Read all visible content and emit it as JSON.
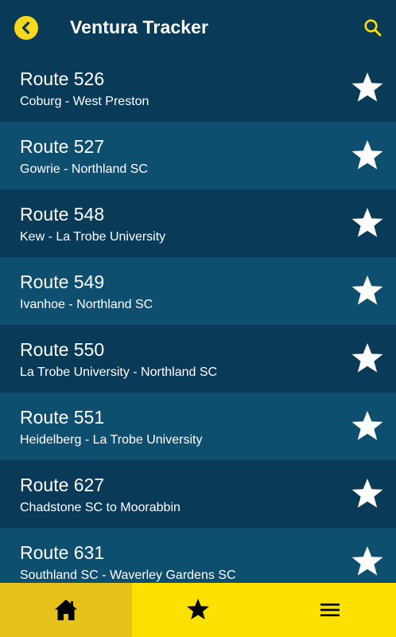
{
  "header": {
    "title": "Ventura Tracker",
    "back_icon": "chevron-left-icon",
    "search_icon": "search-icon"
  },
  "routes": [
    {
      "name": "Route 526",
      "description": "Coburg - West Preston"
    },
    {
      "name": "Route 527",
      "description": "Gowrie - Northland SC"
    },
    {
      "name": "Route 548",
      "description": "Kew - La Trobe University"
    },
    {
      "name": "Route 549",
      "description": "Ivanhoe - Northland SC"
    },
    {
      "name": "Route 550",
      "description": "La Trobe University - Northland SC"
    },
    {
      "name": "Route 551",
      "description": "Heidelberg - La Trobe University"
    },
    {
      "name": "Route 627",
      "description": "Chadstone SC to Moorabbin"
    },
    {
      "name": "Route 631",
      "description": "Southland SC - Waverley Gardens SC"
    }
  ],
  "bottom_nav": {
    "items": [
      {
        "icon": "home-icon",
        "active": true
      },
      {
        "icon": "star-icon",
        "active": false
      },
      {
        "icon": "menu-icon",
        "active": false
      }
    ]
  },
  "colors": {
    "header_bg": "#093a58",
    "row_dark": "#093a58",
    "row_light": "#0e4f70",
    "accent_yellow": "#fce100",
    "nav_active": "#e6c21b"
  }
}
